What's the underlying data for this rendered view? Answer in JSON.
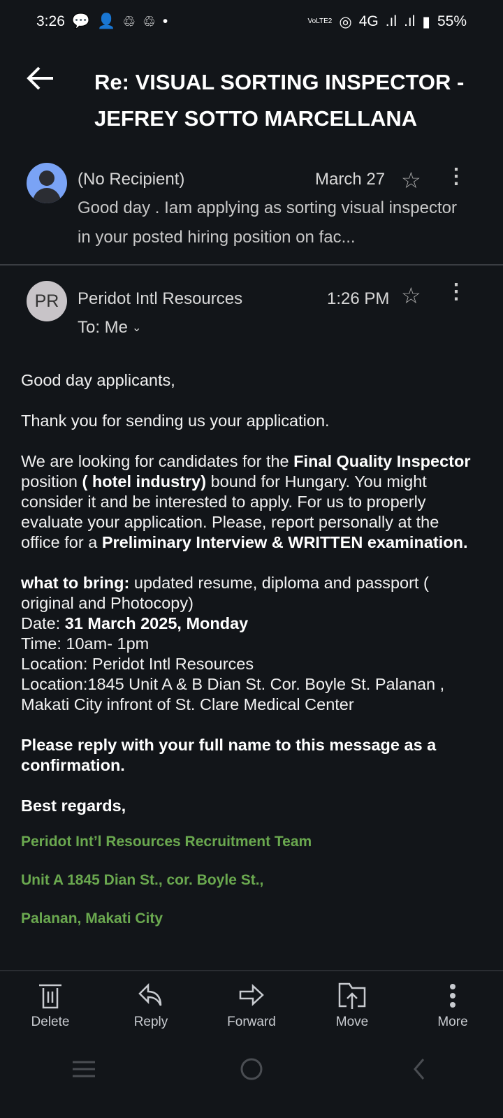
{
  "status": {
    "time": "3:26",
    "network": "4G",
    "battery": "55%"
  },
  "header": {
    "title": "Re: VISUAL SORTING INSPECTOR - JEFREY SOTTO MARCELLANA"
  },
  "thread": [
    {
      "sender": "(No Recipient)",
      "date": "March 27",
      "snippet": "Good day . Iam applying as sorting visual inspector in your posted hiring position on fac..."
    },
    {
      "sender": "Peridot Intl Resources",
      "initials": "PR",
      "date": "1:26 PM",
      "to": "To: Me"
    }
  ],
  "body": {
    "greeting": "Good day applicants,",
    "thanks": "Thank you for sending us your application.",
    "p3": [
      "We are looking for candidates for the ",
      "Final Quality Inspector",
      " position ",
      "( hotel industry)",
      " bound for Hungary. You might consider it and be interested to apply. For us to properly evaluate your application. Please, report personally at the office  for a ",
      "Preliminary Interview & WRITTEN examination."
    ],
    "bring_label": "what to bring:",
    "bring": " updated resume,  diploma and passport ( original and Photocopy)",
    "date_label": "Date: ",
    "date": "31 March 2025, Monday",
    "time": "Time: 10am- 1pm",
    "location1": "Location: Peridot Intl Resources",
    "location2": "Location:1845 Unit A & B Dian St. Cor. Boyle St. Palanan , Makati City infront of St. Clare Medical Center",
    "reply": "Please reply with your full name to this message as a confirmation.",
    "regards": "Best regards,",
    "sig": [
      "Peridot Int’l Resources Recruitment Team",
      "Unit A 1845 Dian St., cor. Boyle St.,",
      "Palanan, Makati City"
    ]
  },
  "actions": [
    "Delete",
    "Reply",
    "Forward",
    "Move",
    "More"
  ],
  "colors": {
    "background": "#121519",
    "signature": "#6aa84f",
    "avatar": "#7aa3f5"
  }
}
